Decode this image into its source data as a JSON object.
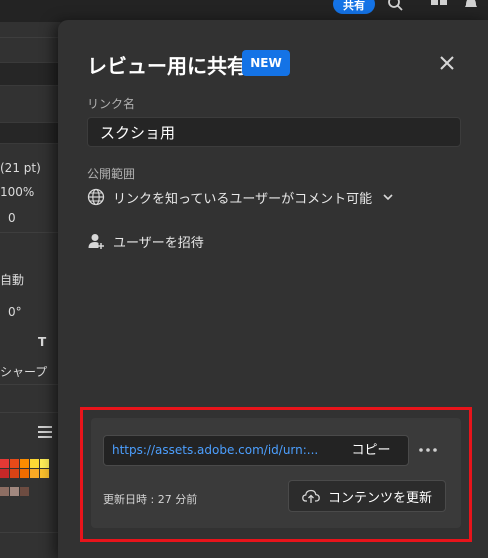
{
  "topbar": {
    "share_label": "共有"
  },
  "left_panel": {
    "size_value": "(21 pt)",
    "scale_value": "100%",
    "offset_value": "0",
    "auto_label": "自動",
    "angle_value": "0°",
    "sharpen_label": "シャープ"
  },
  "share_panel": {
    "title": "レビュー用に共有",
    "badge": "NEW",
    "link_name_label": "リンク名",
    "link_name_value": "スクショ用",
    "access_label": "公開範囲",
    "access_value": "リンクを知っているユーザーがコメント可能",
    "invite_label": "ユーザーを招待",
    "url": "https://assets.adobe.com/id/urn:...",
    "copy_label": "コピー",
    "updated_text": "更新日時 : 27 分前",
    "refresh_label": "コンテンツを更新"
  },
  "colors": {
    "accent": "#1473e6",
    "link": "#4c9ffe",
    "highlight": "#e8141b",
    "panel_bg": "#323232"
  },
  "icons": [
    "close-icon",
    "globe-icon",
    "chevron-down-icon",
    "add-user-icon",
    "more-icon",
    "cloud-upload-icon",
    "search-icon",
    "workspace-icon",
    "bell-icon",
    "list-icon"
  ]
}
